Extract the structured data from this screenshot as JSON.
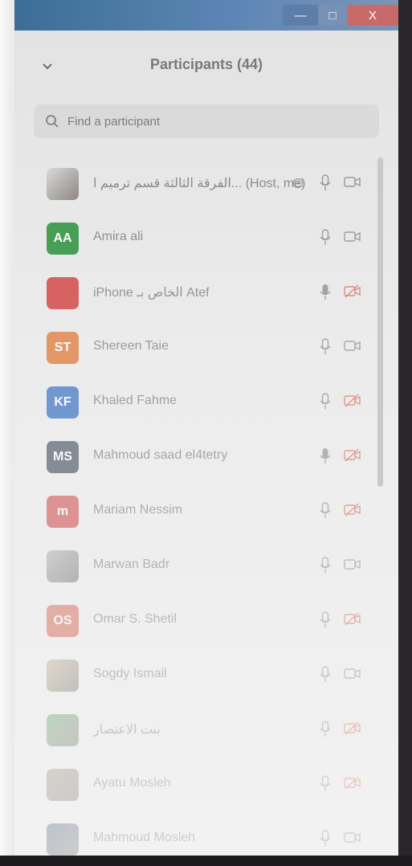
{
  "window": {
    "controls": {
      "minimize": "—",
      "maximize": "□",
      "close": "X"
    }
  },
  "panel": {
    "title": "Participants (44)",
    "collapse_icon": "chevron-down-icon",
    "search": {
      "placeholder": "Find a participant",
      "value": ""
    }
  },
  "participants": [
    {
      "initials": "",
      "avatar_kind": "photo",
      "avatar_color": "#d9d9d9",
      "name": "الفرقة الثالثة قسم ترميم ا...",
      "host_label": "(Host, me)",
      "mic": "unmuted",
      "video": "off"
    },
    {
      "initials": "AA",
      "avatar_kind": "initials",
      "avatar_color": "#3c9a4e",
      "name": "Amira ali",
      "mic": "unmuted",
      "video": "off"
    },
    {
      "initials": "",
      "avatar_kind": "initials",
      "avatar_color": "#d45050",
      "name": "iPhone الخاص بـ Atef",
      "mic": "muted",
      "video": "off-red"
    },
    {
      "initials": "ST",
      "avatar_kind": "initials",
      "avatar_color": "#e2854a",
      "name": "Shereen Taie",
      "mic": "unmuted",
      "video": "off"
    },
    {
      "initials": "KF",
      "avatar_kind": "initials",
      "avatar_color": "#4a7fc6",
      "name": "Khaled Fahme",
      "mic": "unmuted",
      "video": "off-red"
    },
    {
      "initials": "MS",
      "avatar_kind": "initials",
      "avatar_color": "#5b6470",
      "name": "Mahmoud saad el4tetry",
      "mic": "muted",
      "video": "off-red"
    },
    {
      "initials": "m",
      "avatar_kind": "initials",
      "avatar_color": "#d46060",
      "name": "Mariam Nessim",
      "mic": "unmuted",
      "video": "off-red"
    },
    {
      "initials": "",
      "avatar_kind": "photo",
      "avatar_color": "#b8b8bc",
      "name": "Marwan Badr",
      "mic": "unmuted",
      "video": "off"
    },
    {
      "initials": "OS",
      "avatar_kind": "initials",
      "avatar_color": "#d9735e",
      "name": "Omar S. Shetil",
      "mic": "unmuted",
      "video": "off-red"
    },
    {
      "initials": "",
      "avatar_kind": "photo",
      "avatar_color": "#c9b8a0",
      "name": "Sogdy Ismail",
      "mic": "unmuted",
      "video": "off"
    },
    {
      "initials": "",
      "avatar_kind": "photo",
      "avatar_color": "#6fae7a",
      "name": "بنت الاعتصار",
      "mic": "unmuted",
      "video": "off-red"
    },
    {
      "initials": "",
      "avatar_kind": "photo",
      "avatar_color": "#a09a88",
      "name": "Ayatu Mosleh",
      "mic": "unmuted",
      "video": "off-red"
    },
    {
      "initials": "",
      "avatar_kind": "photo",
      "avatar_color": "#5c6f86",
      "name": "Mahmoud Mosleh",
      "mic": "unmuted",
      "video": "off"
    }
  ],
  "colors": {
    "muted_red": "#d9806f",
    "icon_gray": "#9a9a9a"
  }
}
